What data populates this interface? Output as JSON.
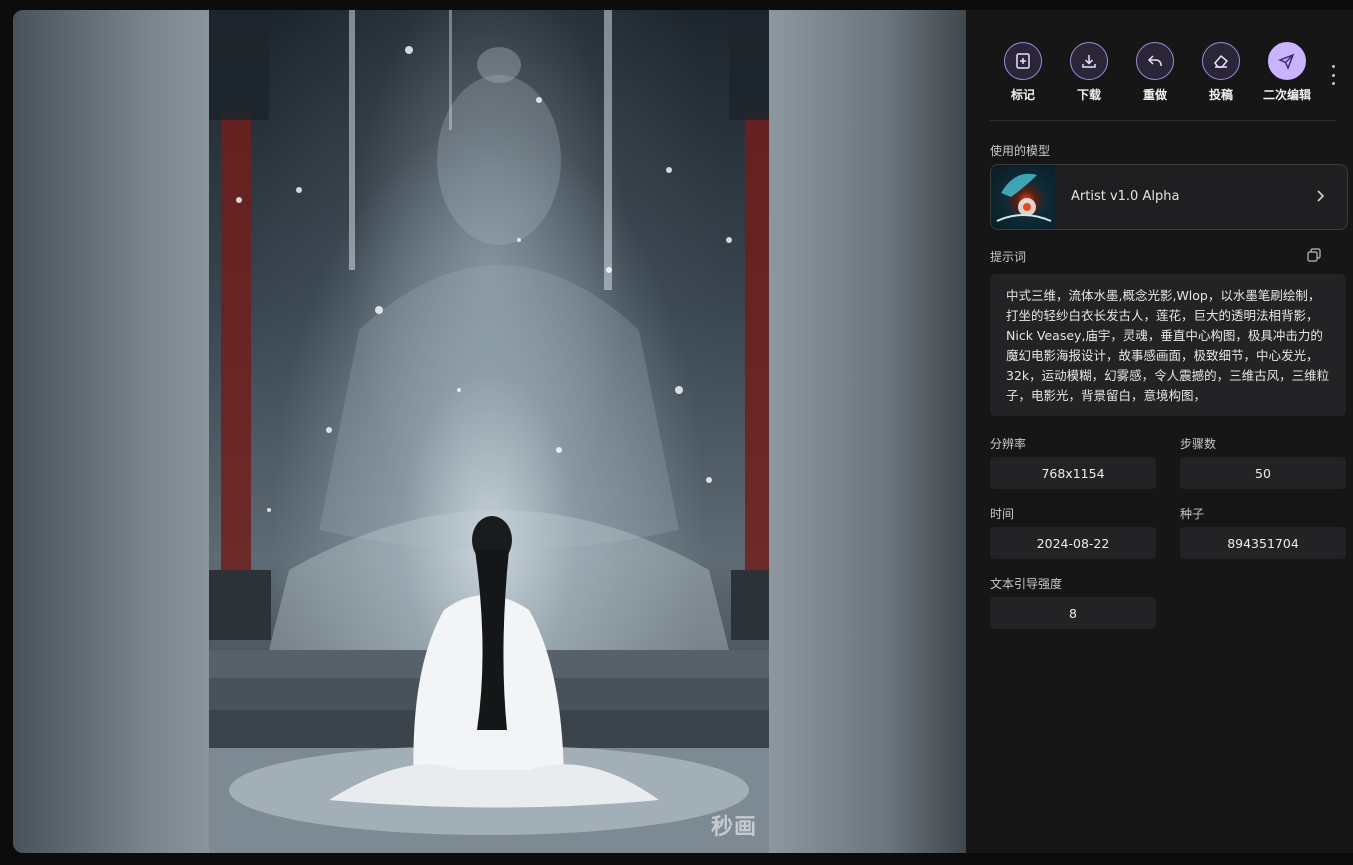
{
  "actions": [
    {
      "id": "mark",
      "label": "标记",
      "icon": "bookmark-plus-icon"
    },
    {
      "id": "download",
      "label": "下载",
      "icon": "download-icon"
    },
    {
      "id": "redo",
      "label": "重做",
      "icon": "reply-icon"
    },
    {
      "id": "submit",
      "label": "投稿",
      "icon": "eraser-icon"
    },
    {
      "id": "reedit",
      "label": "二次编辑",
      "icon": "send-icon"
    }
  ],
  "model": {
    "section_label": "使用的模型",
    "name": "Artist v1.0 Alpha"
  },
  "prompt": {
    "section_label": "提示词",
    "text": "中式三维，流体水墨,概念光影,Wlop，以水墨笔刷绘制，打坐的轻纱白衣长发古人，莲花，巨大的透明法相背影，Nick Veasey,庙宇，灵魂，垂直中心构图，极具冲击力的魔幻电影海报设计，故事感画面，极致细节，中心发光，32k，运动模糊，幻雾感，令人震撼的，三维古风，三维粒子，电影光，背景留白，意境构图，"
  },
  "params": {
    "resolution": {
      "label": "分辨率",
      "value": "768x1154"
    },
    "steps": {
      "label": "步骤数",
      "value": "50"
    },
    "time": {
      "label": "时间",
      "value": "2024-08-22"
    },
    "seed": {
      "label": "种子",
      "value": "894351704"
    },
    "guidance": {
      "label": "文本引导强度",
      "value": "8"
    }
  },
  "watermark": "秒画",
  "colors": {
    "accent": "#c8b4ff",
    "panel_bg": "#161617",
    "field_bg": "#232325"
  }
}
